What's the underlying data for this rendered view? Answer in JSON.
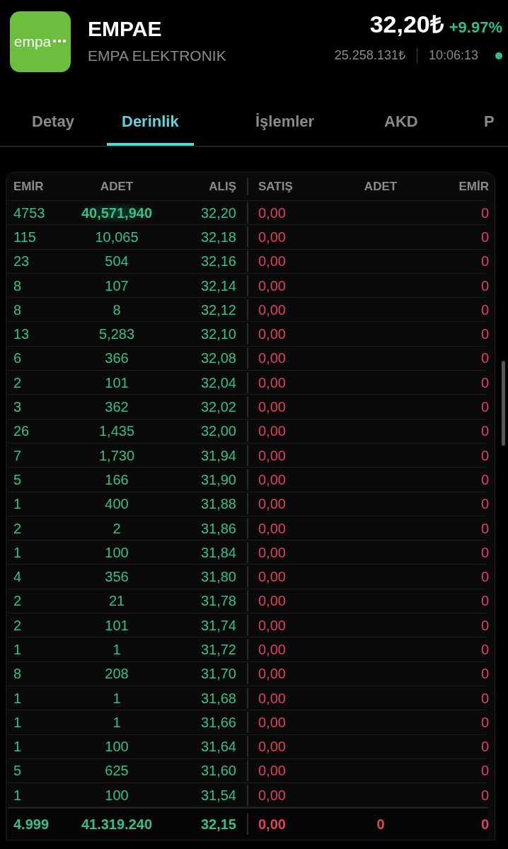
{
  "stock": {
    "logo_text": "empa",
    "symbol": "EMPAE",
    "name": "EMPA ELEKTRONIK",
    "price": "32,20₺",
    "change": "+9.97%",
    "volume": "25.258.131₺",
    "time": "10:06:13",
    "live": true
  },
  "tabs": [
    {
      "label": "Detay",
      "selected": false
    },
    {
      "label": "Derinlik",
      "selected": true
    },
    {
      "label": "İşlemler",
      "selected": false
    },
    {
      "label": "AKD",
      "selected": false
    },
    {
      "label": "P",
      "selected": false
    }
  ],
  "depth": {
    "columns": [
      "EMİR",
      "ADET",
      "ALIŞ",
      "SATIŞ",
      "ADET",
      "EMİR"
    ],
    "rows": [
      {
        "bid_orders": "4753",
        "bid_qty": "40,571,940",
        "bid": "32,20",
        "ask": "0,00",
        "ask_orders": "0",
        "highlighted": true
      },
      {
        "bid_orders": "115",
        "bid_qty": "10,065",
        "bid": "32,18",
        "ask": "0,00",
        "ask_orders": "0",
        "highlighted": false
      },
      {
        "bid_orders": "23",
        "bid_qty": "504",
        "bid": "32,16",
        "ask": "0,00",
        "ask_orders": "0",
        "highlighted": false
      },
      {
        "bid_orders": "8",
        "bid_qty": "107",
        "bid": "32,14",
        "ask": "0,00",
        "ask_orders": "0",
        "highlighted": false
      },
      {
        "bid_orders": "8",
        "bid_qty": "8",
        "bid": "32,12",
        "ask": "0,00",
        "ask_orders": "0",
        "highlighted": false
      },
      {
        "bid_orders": "13",
        "bid_qty": "5,283",
        "bid": "32,10",
        "ask": "0,00",
        "ask_orders": "0",
        "highlighted": false
      },
      {
        "bid_orders": "6",
        "bid_qty": "366",
        "bid": "32,08",
        "ask": "0,00",
        "ask_orders": "0",
        "highlighted": false
      },
      {
        "bid_orders": "2",
        "bid_qty": "101",
        "bid": "32,04",
        "ask": "0,00",
        "ask_orders": "0",
        "highlighted": false
      },
      {
        "bid_orders": "3",
        "bid_qty": "362",
        "bid": "32,02",
        "ask": "0,00",
        "ask_orders": "0",
        "highlighted": false
      },
      {
        "bid_orders": "26",
        "bid_qty": "1,435",
        "bid": "32,00",
        "ask": "0,00",
        "ask_orders": "0",
        "highlighted": false
      },
      {
        "bid_orders": "7",
        "bid_qty": "1,730",
        "bid": "31,94",
        "ask": "0,00",
        "ask_orders": "0",
        "highlighted": false
      },
      {
        "bid_orders": "5",
        "bid_qty": "166",
        "bid": "31,90",
        "ask": "0,00",
        "ask_orders": "0",
        "highlighted": false
      },
      {
        "bid_orders": "1",
        "bid_qty": "400",
        "bid": "31,88",
        "ask": "0,00",
        "ask_orders": "0",
        "highlighted": false
      },
      {
        "bid_orders": "2",
        "bid_qty": "2",
        "bid": "31,86",
        "ask": "0,00",
        "ask_orders": "0",
        "highlighted": false
      },
      {
        "bid_orders": "1",
        "bid_qty": "100",
        "bid": "31,84",
        "ask": "0,00",
        "ask_orders": "0",
        "highlighted": false
      },
      {
        "bid_orders": "4",
        "bid_qty": "356",
        "bid": "31,80",
        "ask": "0,00",
        "ask_orders": "0",
        "highlighted": false
      },
      {
        "bid_orders": "2",
        "bid_qty": "21",
        "bid": "31,78",
        "ask": "0,00",
        "ask_orders": "0",
        "highlighted": false
      },
      {
        "bid_orders": "2",
        "bid_qty": "101",
        "bid": "31,74",
        "ask": "0,00",
        "ask_orders": "0",
        "highlighted": false
      },
      {
        "bid_orders": "1",
        "bid_qty": "1",
        "bid": "31,72",
        "ask": "0,00",
        "ask_orders": "0",
        "highlighted": false
      },
      {
        "bid_orders": "8",
        "bid_qty": "208",
        "bid": "31,70",
        "ask": "0,00",
        "ask_orders": "0",
        "highlighted": false
      },
      {
        "bid_orders": "1",
        "bid_qty": "1",
        "bid": "31,68",
        "ask": "0,00",
        "ask_orders": "0",
        "highlighted": false
      },
      {
        "bid_orders": "1",
        "bid_qty": "1",
        "bid": "31,66",
        "ask": "0,00",
        "ask_orders": "0",
        "highlighted": false
      },
      {
        "bid_orders": "1",
        "bid_qty": "100",
        "bid": "31,64",
        "ask": "0,00",
        "ask_orders": "0",
        "highlighted": false
      },
      {
        "bid_orders": "5",
        "bid_qty": "625",
        "bid": "31,60",
        "ask": "0,00",
        "ask_orders": "0",
        "highlighted": false
      },
      {
        "bid_orders": "1",
        "bid_qty": "100",
        "bid": "31,54",
        "ask": "0,00",
        "ask_orders": "0",
        "highlighted": false
      }
    ],
    "total": {
      "bid_orders": "4.999",
      "bid_qty": "41.319.240",
      "bid": "32,15",
      "ask": "0,00",
      "ask_qty": "0",
      "ask_orders": "0"
    }
  }
}
